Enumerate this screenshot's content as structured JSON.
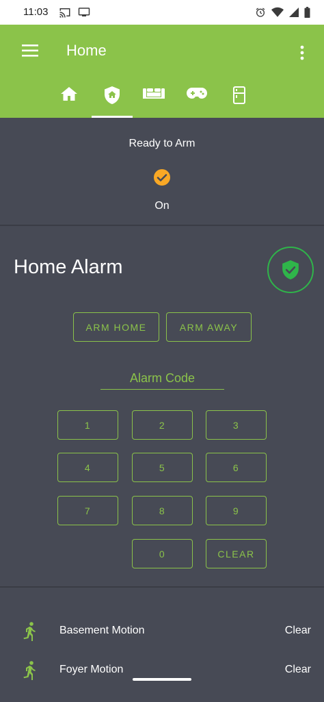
{
  "status_bar": {
    "time": "11:03",
    "left_icons": [
      "cast-icon",
      "screen-icon"
    ],
    "right_icons": [
      "alarm-clock-icon",
      "wifi-icon",
      "signal-icon",
      "battery-icon"
    ]
  },
  "app_bar": {
    "title": "Home",
    "menu_icon": "menu-icon",
    "more_icon": "more-vert-icon",
    "color": "#8bc34a"
  },
  "tabs": [
    {
      "icon": "home-icon",
      "active": false
    },
    {
      "icon": "home-shield-icon",
      "active": true
    },
    {
      "icon": "sofa-icon",
      "active": false
    },
    {
      "icon": "gamepad-icon",
      "active": false
    },
    {
      "icon": "fridge-icon",
      "active": false
    }
  ],
  "ready_card": {
    "label": "Ready to Arm",
    "state": "On",
    "icon": "check-circle-icon",
    "icon_color": "#f9a825"
  },
  "alarm_panel": {
    "title": "Home Alarm",
    "status_icon": "shield-check-icon",
    "status_color": "#2fb54a",
    "arm_home_label": "ARM HOME",
    "arm_away_label": "ARM AWAY",
    "code_placeholder": "Alarm Code",
    "keys": [
      "1",
      "2",
      "3",
      "4",
      "5",
      "6",
      "7",
      "8",
      "9",
      "0",
      "CLEAR"
    ],
    "accent": "#8bc34a"
  },
  "entities": [
    {
      "name": "Basement Motion",
      "state": "Clear",
      "icon": "walk-icon"
    },
    {
      "name": "Foyer Motion",
      "state": "Clear",
      "icon": "walk-icon"
    }
  ],
  "theme": {
    "background": "#474a55",
    "text": "#ffffff"
  }
}
